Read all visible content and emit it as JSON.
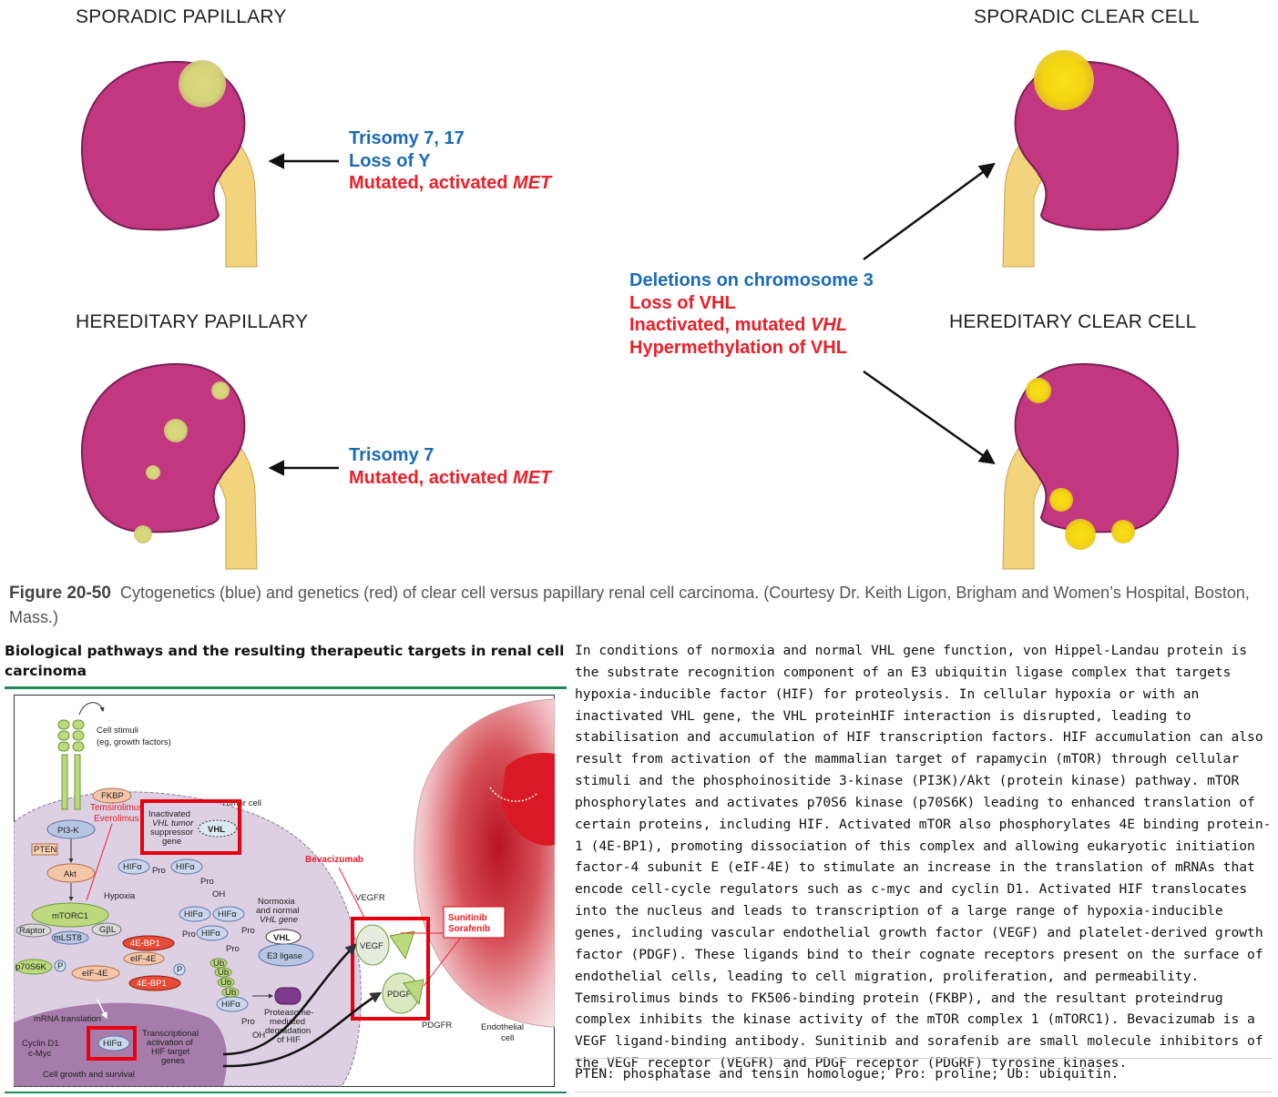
{
  "figure": {
    "titles": {
      "sporadic_papillary": "SPORADIC PAPILLARY",
      "hereditary_papillary": "HEREDITARY PAPILLARY",
      "sporadic_clear_cell": "SPORADIC CLEAR CELL",
      "hereditary_clear_cell": "HEREDITARY CLEAR CELL"
    },
    "sporadic_papillary_genes": {
      "line1": "Trisomy 7, 17",
      "line2": "Loss of Y",
      "line3_prefix": "Mutated, activated ",
      "line3_gene": "MET"
    },
    "hereditary_papillary_genes": {
      "line1": "Trisomy 7",
      "line2_prefix": "Mutated, activated ",
      "line2_gene": "MET"
    },
    "clear_cell_genes": {
      "line1": "Deletions on chromosome 3",
      "line2": "Loss of VHL",
      "line3_prefix": "Inactivated, mutated ",
      "line3_gene": "VHL",
      "line4": "Hypermethylation of VHL"
    },
    "colors": {
      "kidney": "#c2377f",
      "pelvis": "#f2d47c",
      "papillary_tumor": "#d6d87a",
      "clear_tumor": "#f3d60f",
      "cytogenetics": "#1a6bb5",
      "genetics": "#e8202a"
    },
    "caption": {
      "label": "Figure 20-50",
      "text": "Cytogenetics (blue) and genetics (red) of clear cell versus papillary renal cell carcinoma. (Courtesy Dr. Keith Ligon, Brigham and Women’s Hospital, Boston, Mass.)"
    }
  },
  "pathway": {
    "title": "Biological pathways and the resulting therapeutic targets in renal cell carcinoma",
    "labels": {
      "cell_stimuli": "Cell stimuli",
      "growth_factors": "(eg, growth factors)",
      "tumor_cell": "Tumor cell",
      "fkbp": "FKBP",
      "temsirolimus": "Temsirolimus",
      "everolimus": "Everolimus",
      "pi3k": "PI3-K",
      "pten": "PTEN",
      "akt": "Akt",
      "inactivated1": "Inactivated",
      "inactivated2": "VHL tumor",
      "inactivated3": "suppressor",
      "inactivated4": "gene",
      "vhl": "VHL",
      "hifa": "HIFα",
      "pro": "Pro",
      "oh": "OH",
      "hypoxia": "Hypoxia",
      "normoxia1": "Normoxia",
      "normoxia2": "and normal",
      "normoxia3": "VHL gene",
      "e3_ligase": "E3 ligase",
      "mtorc1": "mTORC1",
      "raptor": "Raptor",
      "gbl": "GβL",
      "mlst8": "mLST8",
      "ebp1": "4E-BP1",
      "eif4e": "eIF-4E",
      "p70s6k": "p70S6K",
      "p": "P",
      "ub": "Ub",
      "proteasome1": "Proteasome-",
      "proteasome2": "mediated",
      "proteasome3": "degradation",
      "proteasome4": "of HIF",
      "mrna_translation": "mRNA translation",
      "cyclin_d1": "Cyclin D1",
      "c_myc": "c-Myc",
      "transcriptional1": "Transcriptional",
      "transcriptional2": "activation of",
      "transcriptional3": "HIF target",
      "transcriptional4": "genes",
      "growth_survival": "Cell growth and survival",
      "bevacizumab": "Bevacizumab",
      "vegfr": "VEGFR",
      "vegf": "VEGF",
      "pdgf": "PDGF",
      "pdgfr": "PDGFR",
      "sunitinib": "Sunitinib",
      "sorafenib": "Sorafenib",
      "endothelial1": "Endothelial",
      "endothelial2": "cell"
    },
    "description": "In conditions of normoxia and normal VHL gene function, von Hippel-Landau protein is the substrate recognition component of an E3 ubiquitin ligase complex that targets hypoxia-inducible factor (HIF) for proteolysis. In cellular hypoxia or with an inactivated VHL gene, the VHL proteinHIF interaction is disrupted, leading to stabilisation and accumulation of HIF transcription factors. HIF accumulation can also result from activation of the mammalian target of rapamycin (mTOR) through cellular stimuli and the phosphoinositide 3-kinase (PI3K)/Akt (protein kinase) pathway. mTOR phosphorylates and activates p70S6 kinase (p70S6K) leading to enhanced translation of certain proteins, including HIF. Activated mTOR also phosphorylates 4E binding protein-1 (4E-BP1), promoting dissociation of this complex and allowing eukaryotic initiation factor-4 subunit E (eIF-4E) to stimulate an increase in the translation of mRNAs that encode cell-cycle regulators such as c-myc and cyclin D1. Activated HIF translocates into the nucleus and leads to transcription of a large range of hypoxia-inducible genes, including vascular endothelial growth factor (VEGF) and platelet-derived growth factor (PDGF). These ligands bind to their cognate receptors present on the surface of endothelial cells, leading to cell migration, proliferation, and permeability. Temsirolimus binds to FK506-binding protein (FKBP), and the resultant proteindrug complex inhibits the kinase activity of the mTOR complex 1 (mTORC1). Bevacizumab is a VEGF ligand-binding antibody. Sunitinib and sorafenib are small molecule inhibitors of the VEGF receptor (VEGFR) and PDGF receptor (PDGRF) tyrosine kinases.",
    "footnote": "PTEN: phosphatase and tensin homologue; Pro: proline; Ub: ubiquitin."
  }
}
